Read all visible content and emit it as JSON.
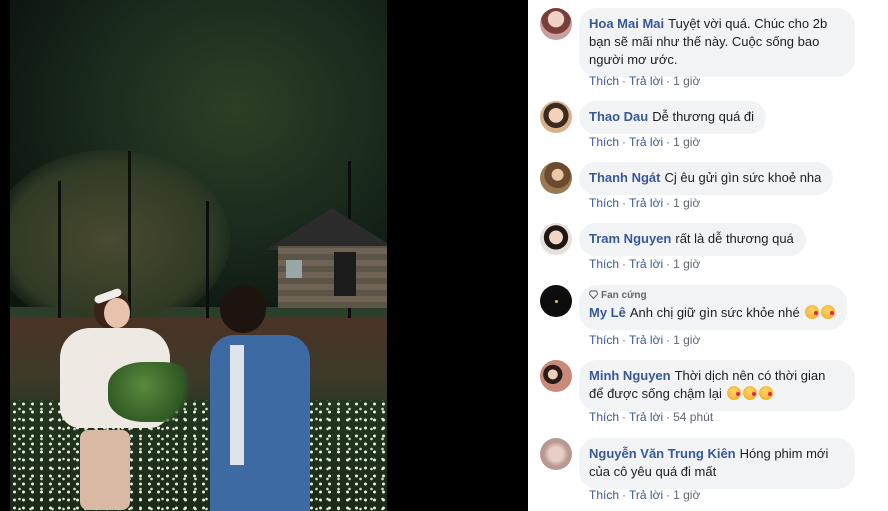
{
  "comments": [
    {
      "author": "Hoa Mai Mai",
      "text": "Tuyệt vời quá. Chúc cho 2b bạn sẽ mãi như thế này. Cuộc sống bao người mơ ước.",
      "like": "Thích",
      "reply": "Trả lời",
      "time": "1 giờ",
      "avatar_color": "#c9a0a0"
    },
    {
      "author": "Thao Dau",
      "text": "Dễ thương quá đi",
      "like": "Thích",
      "reply": "Trả lời",
      "time": "1 giờ",
      "avatar_color": "#d8b08a"
    },
    {
      "author": "Thanh Ngát",
      "text": "Cj êu gửi gìn sức khoẻ nha",
      "like": "Thích",
      "reply": "Trả lời",
      "time": "1 giờ",
      "avatar_color": "#9a7a52"
    },
    {
      "author": "Tram Nguyen",
      "text": "rất là dễ thương quá",
      "like": "Thích",
      "reply": "Trả lời",
      "time": "1 giờ",
      "avatar_color": "#e6e1dc"
    },
    {
      "badge": "Fan cứng",
      "author": "My Lê",
      "text": "Anh chị giữ gìn sức khỏe nhé",
      "like": "Thích",
      "reply": "Trả lời",
      "time": "1 giờ",
      "avatar_color": "#111111"
    },
    {
      "author": "Minh Nguyen",
      "text": "Thời dịch nên có thời gian để được sống chậm lại",
      "like": "Thích",
      "reply": "Trả lời",
      "time": "54 phút",
      "avatar_color": "#c98a7a"
    },
    {
      "author": "Nguyễn Văn Trung Kiên",
      "text": "Hóng phim mới của cô yêu quá đi mất",
      "like": "Thích",
      "reply": "Trả lời",
      "time": "1 giờ",
      "avatar_color": "#b89890"
    }
  ],
  "emoji_icon": "kissing-heart-icon",
  "colors": {
    "link": "#385898",
    "bubble": "#f2f3f5",
    "meta": "#606770"
  }
}
